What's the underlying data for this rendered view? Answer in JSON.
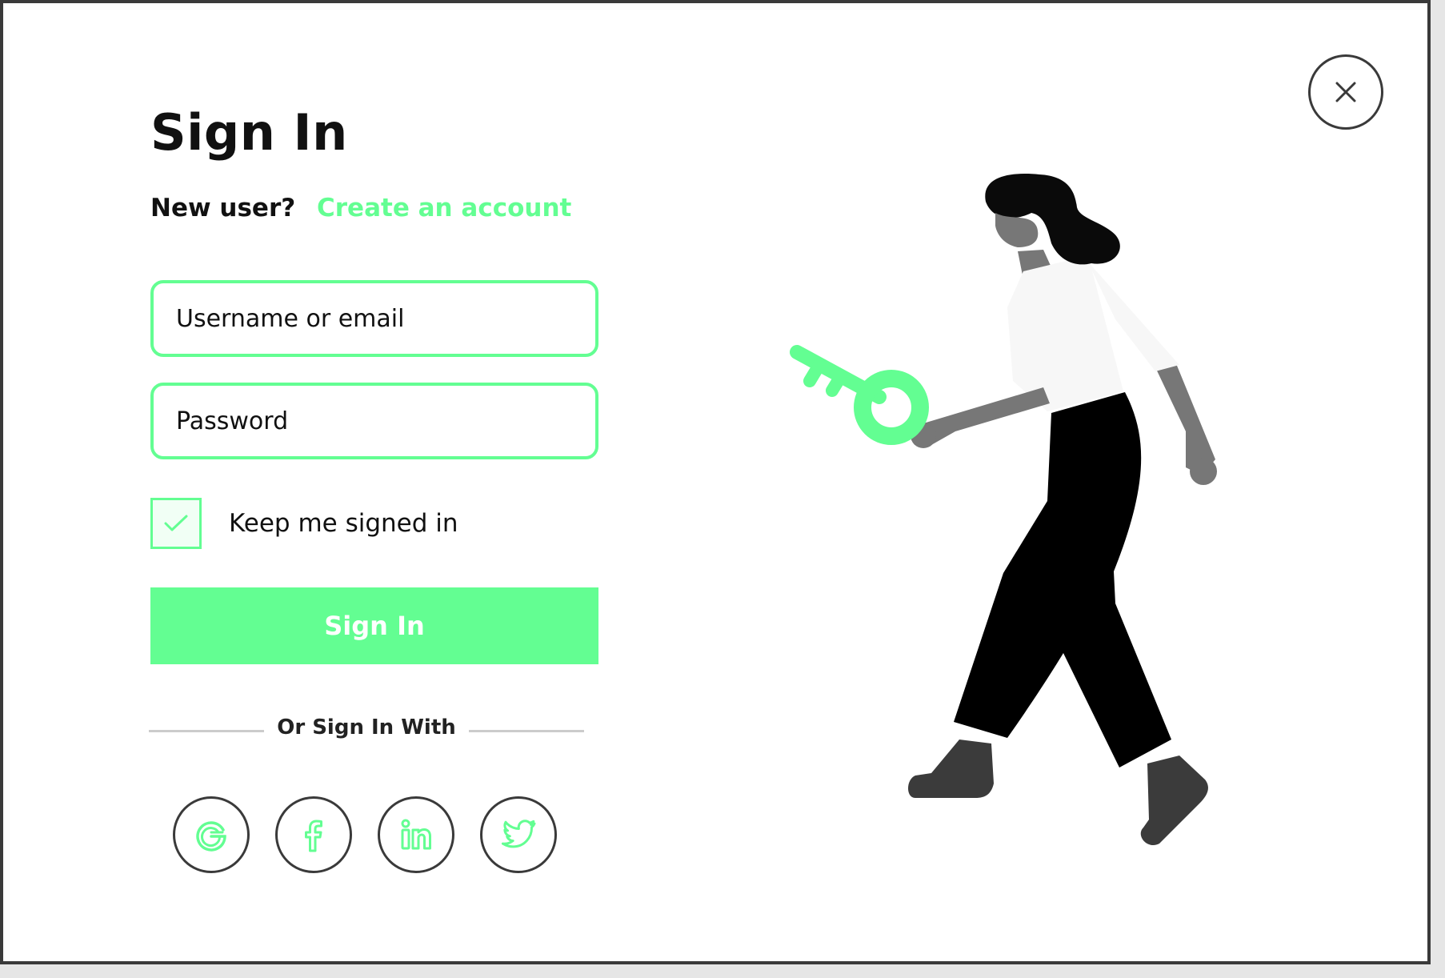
{
  "dialog": {
    "title": "Sign In",
    "new_user_prompt": "New user?",
    "create_account_link": "Create an account",
    "username_placeholder": "Username or email",
    "password_placeholder": "Password",
    "keep_signed_in_label": "Keep me signed in",
    "keep_signed_in_checked": true,
    "sign_in_button": "Sign In",
    "divider_text": "Or Sign In With",
    "social_providers": [
      {
        "name": "Google",
        "icon": "google-icon"
      },
      {
        "name": "Facebook",
        "icon": "facebook-icon"
      },
      {
        "name": "LinkedIn",
        "icon": "linkedin-icon"
      },
      {
        "name": "Twitter",
        "icon": "twitter-icon"
      }
    ],
    "close_icon": "close-icon",
    "illustration": "woman-holding-key-illustration"
  },
  "colors": {
    "accent": "#63fe92",
    "text": "#111111",
    "border_dark": "#3a3a3a",
    "divider": "#cccccc",
    "skin": "#777777",
    "shoe": "#3b3b3b"
  }
}
